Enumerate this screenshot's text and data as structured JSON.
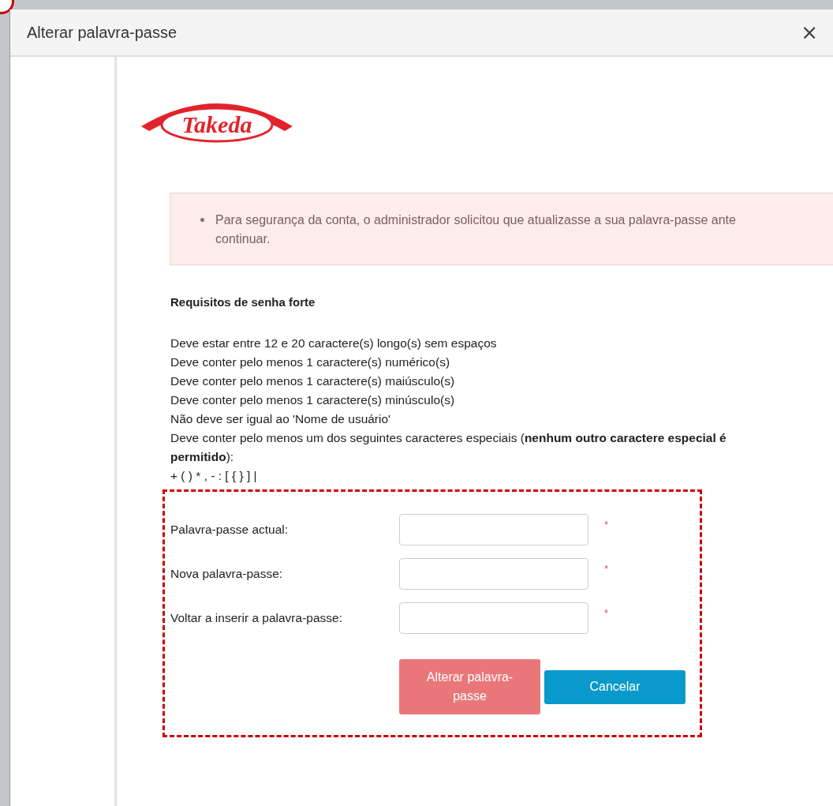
{
  "window": {
    "title": "Alterar palavra-passe",
    "close": "×"
  },
  "logo": {
    "text": "Takeda"
  },
  "alert": {
    "items": [
      {
        "lines": [
          "Para segurança da conta, o administrador solicitou que atualizasse a sua palavra-passe ante",
          "continuar."
        ]
      }
    ]
  },
  "requirements": {
    "title": "Requisitos de senha forte",
    "items": [
      "Deve estar entre 12 e 20 caractere(s) longo(s) sem espaços",
      "Deve conter pelo menos 1 caractere(s) numérico(s)",
      "Deve conter pelo menos 1 caractere(s) maiúsculo(s)",
      "Deve conter pelo menos 1 caractere(s) minúsculo(s)",
      "Não deve ser igual ao 'Nome de usuário'",
      "Deve conter pelo menos um dos seguintes caracteres especiais (**nenhum outro caractere especial é permitido**):",
      "+ ( ) * , - : [ { } ] |"
    ]
  },
  "form": {
    "fields": [
      {
        "label": "Palavra-passe actual:",
        "required_mark": "*"
      },
      {
        "label": "Nova palavra-passe:",
        "required_mark": "*"
      },
      {
        "label": "Voltar a inserir a palavra-passe:",
        "required_mark": "*"
      }
    ],
    "buttons": [
      {
        "label": "Alterar palavra-passe",
        "kind": "primary",
        "disabled": true
      },
      {
        "label": "Cancelar",
        "kind": "secondary",
        "disabled": false
      }
    ]
  }
}
